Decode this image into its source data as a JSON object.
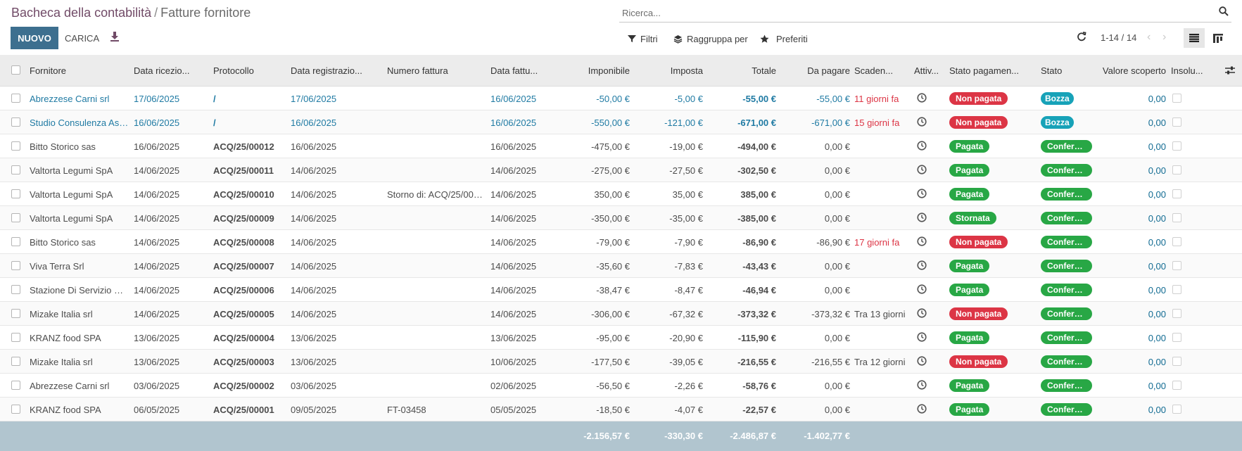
{
  "breadcrumb": {
    "parent": "Bacheca della contabilità",
    "separator": "/",
    "current": "Fatture fornitore"
  },
  "buttons": {
    "new": "NUOVO",
    "upload": "CARICA"
  },
  "search": {
    "placeholder": "Ricerca..."
  },
  "facets": {
    "filters": "Filtri",
    "group_by": "Raggruppa per",
    "favorites": "Preferiti"
  },
  "pager": {
    "text": "1-14 / 14"
  },
  "columns": {
    "vendor": "Fornitore",
    "received": "Data ricezio...",
    "protocol": "Protocollo",
    "registered": "Data registrazio...",
    "invoice_number": "Numero fattura",
    "invoice_date": "Data fattu...",
    "taxable": "Imponibile",
    "tax": "Imposta",
    "total": "Totale",
    "to_pay": "Da pagare",
    "due": "Scaden...",
    "activity": "Attiv...",
    "payment_state": "Stato pagamen...",
    "state": "Stato",
    "uncovered": "Valore scoperto",
    "unpaid": "Insolu..."
  },
  "rows": [
    {
      "vendor": "Abrezzese Carni srl",
      "received": "17/06/2025",
      "protocol": "/",
      "registered": "17/06/2025",
      "invoice_number": "",
      "invoice_date": "16/06/2025",
      "taxable": "-50,00 €",
      "tax": "-5,00 €",
      "total": "-55,00 €",
      "to_pay": "-55,00 €",
      "due": "11 giorni fa",
      "payment_state": "Non pagata",
      "state": "Bozza",
      "uncovered": "0,00"
    },
    {
      "vendor": "Studio Consulenza Ass...",
      "received": "16/06/2025",
      "protocol": "/",
      "registered": "16/06/2025",
      "invoice_number": "",
      "invoice_date": "16/06/2025",
      "taxable": "-550,00 €",
      "tax": "-121,00 €",
      "total": "-671,00 €",
      "to_pay": "-671,00 €",
      "due": "15 giorni fa",
      "payment_state": "Non pagata",
      "state": "Bozza",
      "uncovered": "0,00"
    },
    {
      "vendor": "Bitto Storico sas",
      "received": "16/06/2025",
      "protocol": "ACQ/25/00012",
      "registered": "16/06/2025",
      "invoice_number": "",
      "invoice_date": "16/06/2025",
      "taxable": "-475,00 €",
      "tax": "-19,00 €",
      "total": "-494,00 €",
      "to_pay": "0,00 €",
      "due": "",
      "payment_state": "Pagata",
      "state": "Conferm...",
      "uncovered": "0,00"
    },
    {
      "vendor": "Valtorta Legumi SpA",
      "received": "14/06/2025",
      "protocol": "ACQ/25/00011",
      "registered": "14/06/2025",
      "invoice_number": "",
      "invoice_date": "14/06/2025",
      "taxable": "-275,00 €",
      "tax": "-27,50 €",
      "total": "-302,50 €",
      "to_pay": "0,00 €",
      "due": "",
      "payment_state": "Pagata",
      "state": "Conferm...",
      "uncovered": "0,00"
    },
    {
      "vendor": "Valtorta Legumi SpA",
      "received": "14/06/2025",
      "protocol": "ACQ/25/00010",
      "registered": "14/06/2025",
      "invoice_number": "Storno di: ACQ/25/000...",
      "invoice_date": "14/06/2025",
      "taxable": "350,00 €",
      "tax": "35,00 €",
      "total": "385,00 €",
      "to_pay": "0,00 €",
      "due": "",
      "payment_state": "Pagata",
      "state": "Conferm...",
      "uncovered": "0,00"
    },
    {
      "vendor": "Valtorta Legumi SpA",
      "received": "14/06/2025",
      "protocol": "ACQ/25/00009",
      "registered": "14/06/2025",
      "invoice_number": "",
      "invoice_date": "14/06/2025",
      "taxable": "-350,00 €",
      "tax": "-35,00 €",
      "total": "-385,00 €",
      "to_pay": "0,00 €",
      "due": "",
      "payment_state": "Stornata",
      "state": "Conferm...",
      "uncovered": "0,00"
    },
    {
      "vendor": "Bitto Storico sas",
      "received": "14/06/2025",
      "protocol": "ACQ/25/00008",
      "registered": "14/06/2025",
      "invoice_number": "",
      "invoice_date": "14/06/2025",
      "taxable": "-79,00 €",
      "tax": "-7,90 €",
      "total": "-86,90 €",
      "to_pay": "-86,90 €",
      "due": "17 giorni fa",
      "payment_state": "Non pagata",
      "state": "Conferm...",
      "uncovered": "0,00"
    },
    {
      "vendor": "Viva Terra Srl",
      "received": "14/06/2025",
      "protocol": "ACQ/25/00007",
      "registered": "14/06/2025",
      "invoice_number": "",
      "invoice_date": "14/06/2025",
      "taxable": "-35,60 €",
      "tax": "-7,83 €",
      "total": "-43,43 €",
      "to_pay": "0,00 €",
      "due": "",
      "payment_state": "Pagata",
      "state": "Conferm...",
      "uncovered": "0,00"
    },
    {
      "vendor": "Stazione Di Servizio Di...",
      "received": "14/06/2025",
      "protocol": "ACQ/25/00006",
      "registered": "14/06/2025",
      "invoice_number": "",
      "invoice_date": "14/06/2025",
      "taxable": "-38,47 €",
      "tax": "-8,47 €",
      "total": "-46,94 €",
      "to_pay": "0,00 €",
      "due": "",
      "payment_state": "Pagata",
      "state": "Conferm...",
      "uncovered": "0,00"
    },
    {
      "vendor": "Mizake Italia srl",
      "received": "14/06/2025",
      "protocol": "ACQ/25/00005",
      "registered": "14/06/2025",
      "invoice_number": "",
      "invoice_date": "14/06/2025",
      "taxable": "-306,00 €",
      "tax": "-67,32 €",
      "total": "-373,32 €",
      "to_pay": "-373,32 €",
      "due": "Tra 13 giorni",
      "payment_state": "Non pagata",
      "state": "Conferm...",
      "uncovered": "0,00"
    },
    {
      "vendor": "KRANZ food SPA",
      "received": "13/06/2025",
      "protocol": "ACQ/25/00004",
      "registered": "13/06/2025",
      "invoice_number": "",
      "invoice_date": "13/06/2025",
      "taxable": "-95,00 €",
      "tax": "-20,90 €",
      "total": "-115,90 €",
      "to_pay": "0,00 €",
      "due": "",
      "payment_state": "Pagata",
      "state": "Conferm...",
      "uncovered": "0,00"
    },
    {
      "vendor": "Mizake Italia srl",
      "received": "13/06/2025",
      "protocol": "ACQ/25/00003",
      "registered": "13/06/2025",
      "invoice_number": "",
      "invoice_date": "10/06/2025",
      "taxable": "-177,50 €",
      "tax": "-39,05 €",
      "total": "-216,55 €",
      "to_pay": "-216,55 €",
      "due": "Tra 12 giorni",
      "payment_state": "Non pagata",
      "state": "Conferm...",
      "uncovered": "0,00"
    },
    {
      "vendor": "Abrezzese Carni srl",
      "received": "03/06/2025",
      "protocol": "ACQ/25/00002",
      "registered": "03/06/2025",
      "invoice_number": "",
      "invoice_date": "02/06/2025",
      "taxable": "-56,50 €",
      "tax": "-2,26 €",
      "total": "-58,76 €",
      "to_pay": "0,00 €",
      "due": "",
      "payment_state": "Pagata",
      "state": "Conferm...",
      "uncovered": "0,00"
    },
    {
      "vendor": "KRANZ food SPA",
      "received": "06/05/2025",
      "protocol": "ACQ/25/00001",
      "registered": "09/05/2025",
      "invoice_number": "FT-03458",
      "invoice_date": "05/05/2025",
      "taxable": "-18,50 €",
      "tax": "-4,07 €",
      "total": "-22,57 €",
      "to_pay": "0,00 €",
      "due": "",
      "payment_state": "Pagata",
      "state": "Conferm...",
      "uncovered": "0,00"
    }
  ],
  "totals": {
    "taxable": "-2.156,57 €",
    "tax": "-330,30 €",
    "total": "-2.486,87 €",
    "to_pay": "-1.402,77 €"
  },
  "colors": {
    "primary": "#3d6f8f",
    "draft_text": "#1f7aa3",
    "badge_red": "#dc3545",
    "badge_green": "#28a745",
    "badge_blue": "#17a2b8",
    "footer": "#b1c5cf"
  }
}
